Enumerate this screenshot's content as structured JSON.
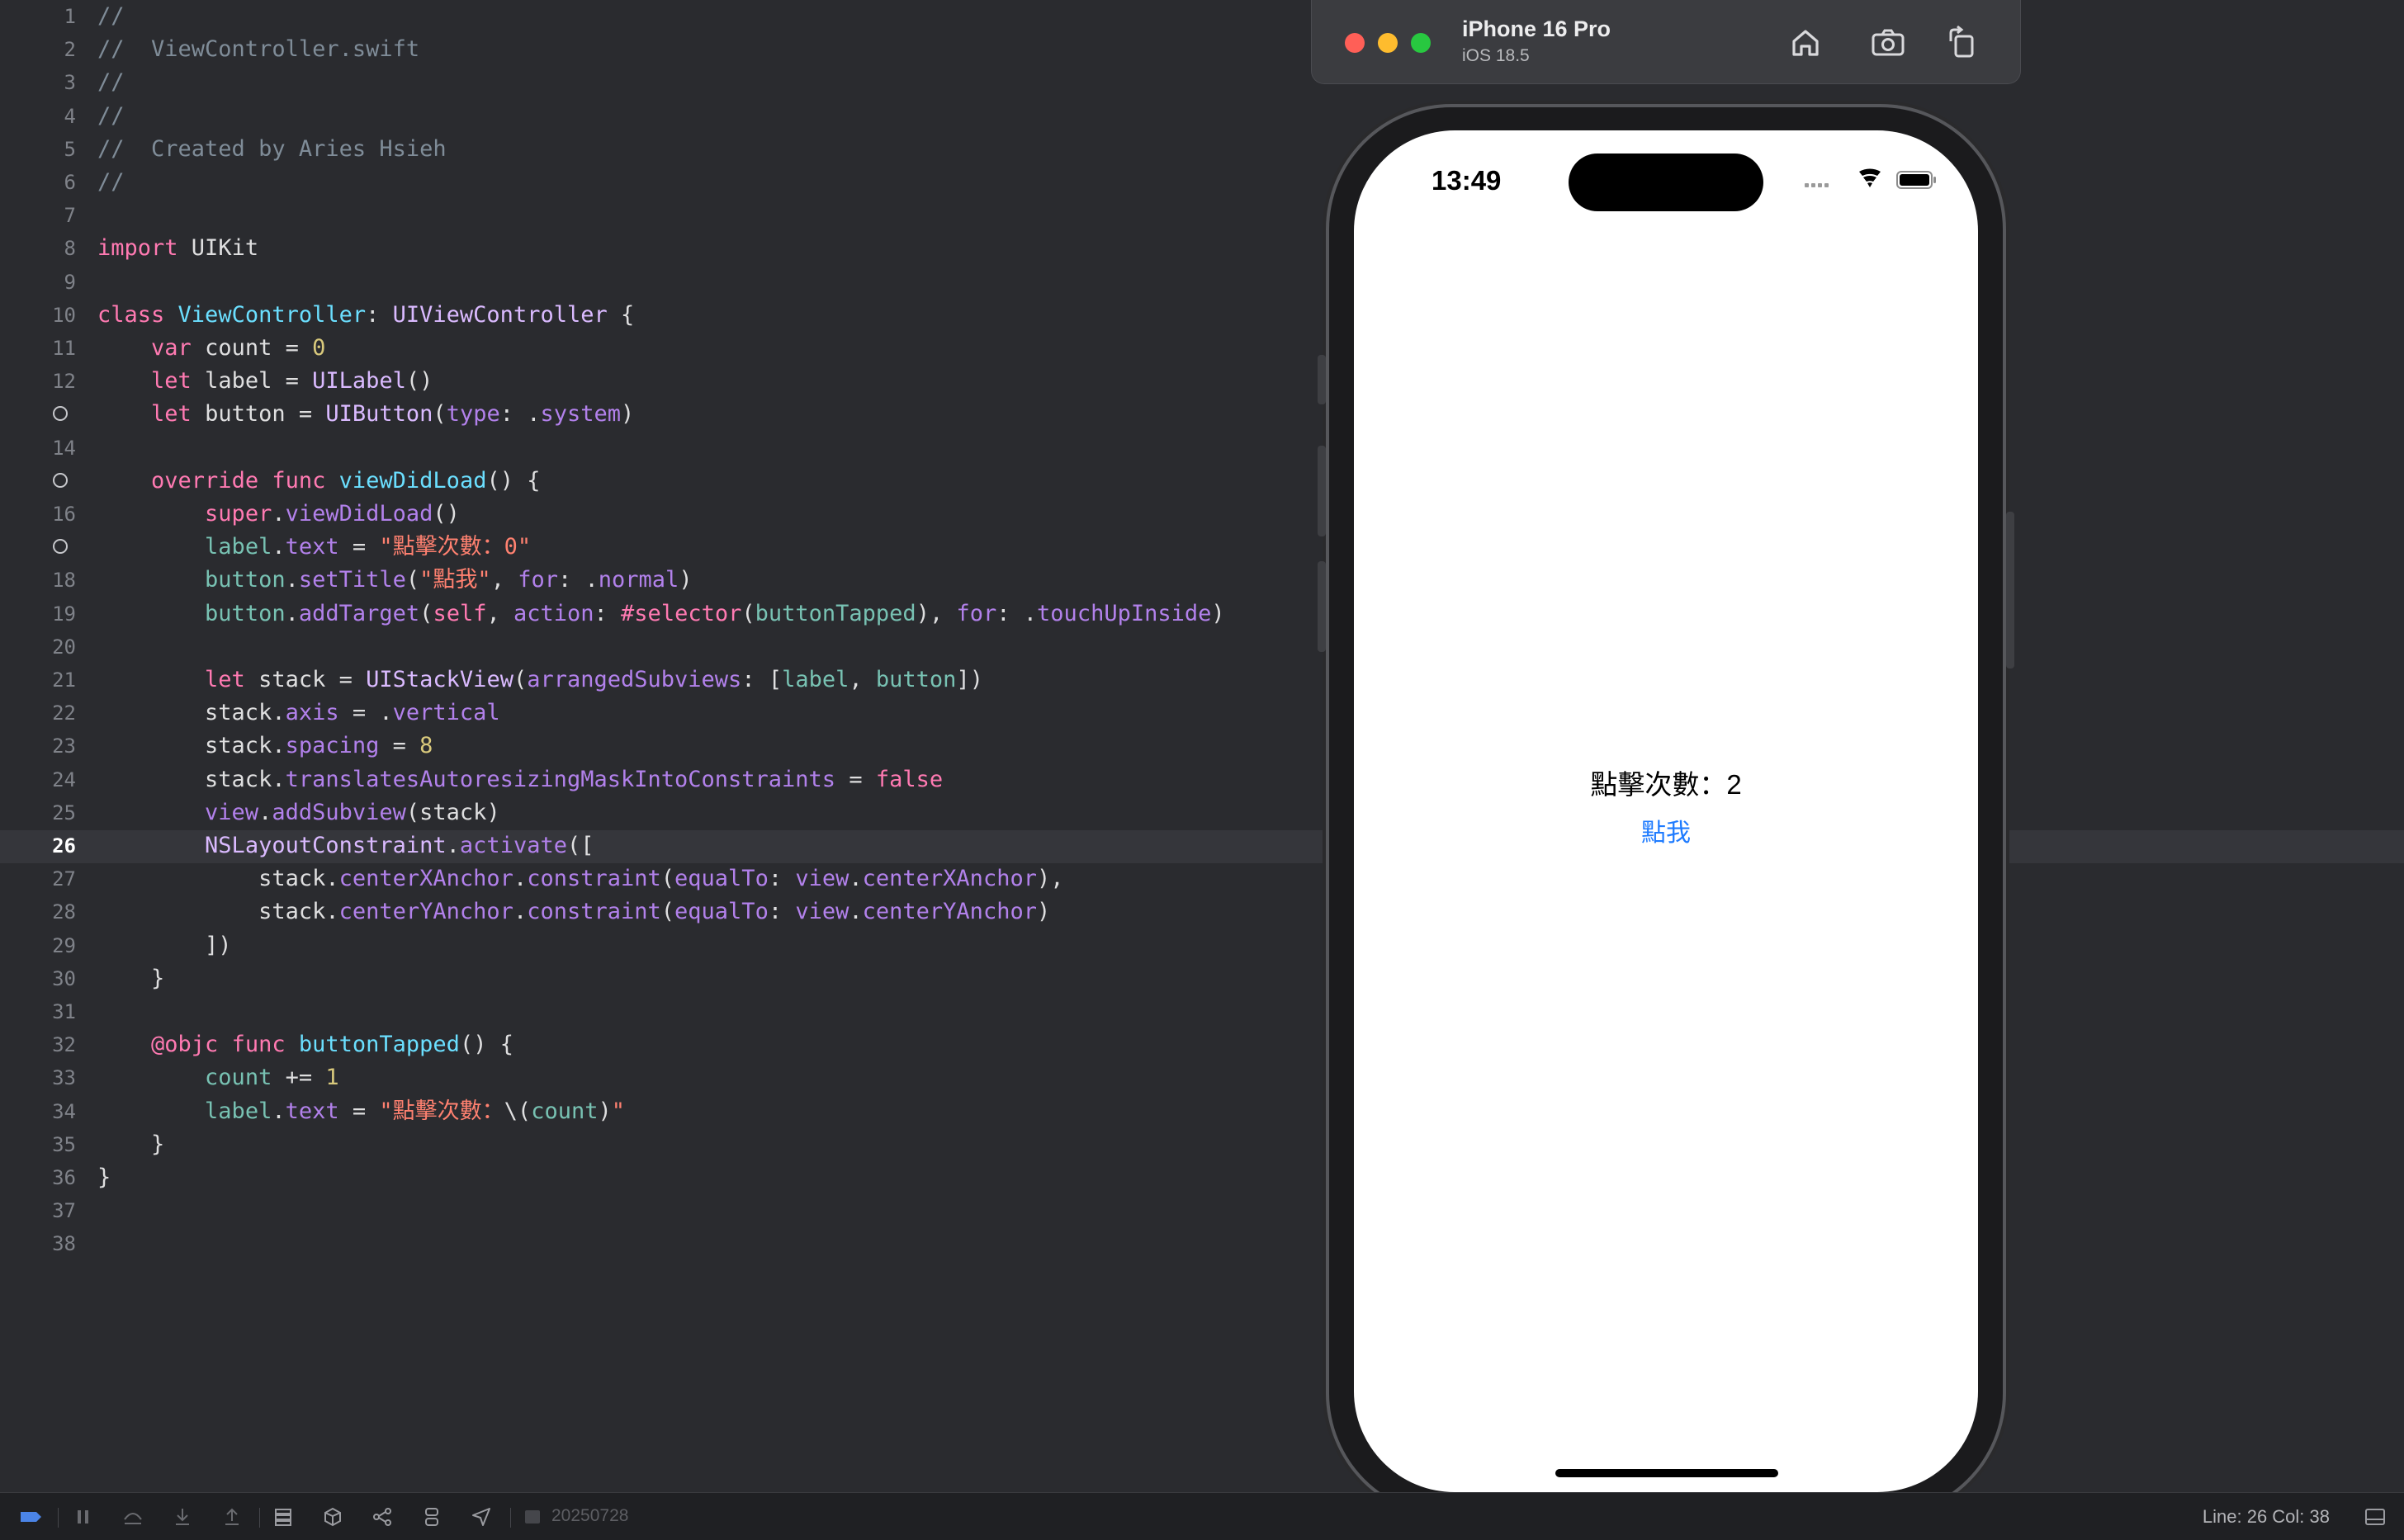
{
  "editor": {
    "current_line": 26,
    "lines": [
      {
        "n": "1",
        "tokens": [
          {
            "t": "//",
            "c": "comment"
          }
        ]
      },
      {
        "n": "2",
        "tokens": [
          {
            "t": "//  ViewController.swift",
            "c": "comment"
          }
        ]
      },
      {
        "n": "3",
        "tokens": [
          {
            "t": "//",
            "c": "comment"
          }
        ]
      },
      {
        "n": "4",
        "tokens": [
          {
            "t": "//",
            "c": "comment"
          }
        ]
      },
      {
        "n": "5",
        "tokens": [
          {
            "t": "//  Created by Aries Hsieh",
            "c": "comment"
          }
        ]
      },
      {
        "n": "6",
        "tokens": [
          {
            "t": "//",
            "c": "comment"
          }
        ]
      },
      {
        "n": "7",
        "tokens": []
      },
      {
        "n": "8",
        "tokens": [
          {
            "t": "import",
            "c": "keyword"
          },
          {
            "t": " UIKit",
            "c": "plain"
          }
        ]
      },
      {
        "n": "9",
        "tokens": []
      },
      {
        "n": "10",
        "tokens": [
          {
            "t": "class",
            "c": "keyword"
          },
          {
            "t": " ",
            "c": "plain"
          },
          {
            "t": "ViewController",
            "c": "project"
          },
          {
            "t": ": ",
            "c": "plain"
          },
          {
            "t": "UIViewController",
            "c": "type"
          },
          {
            "t": " {",
            "c": "plain"
          }
        ]
      },
      {
        "n": "11",
        "tokens": [
          {
            "t": "    ",
            "c": "plain"
          },
          {
            "t": "var",
            "c": "keyword"
          },
          {
            "t": " count = ",
            "c": "plain"
          },
          {
            "t": "0",
            "c": "number"
          }
        ]
      },
      {
        "n": "12",
        "tokens": [
          {
            "t": "    ",
            "c": "plain"
          },
          {
            "t": "let",
            "c": "keyword"
          },
          {
            "t": " label = ",
            "c": "plain"
          },
          {
            "t": "UILabel",
            "c": "type"
          },
          {
            "t": "()",
            "c": "plain"
          }
        ]
      },
      {
        "n": "13",
        "breakpoint": true,
        "tokens": [
          {
            "t": "    ",
            "c": "plain"
          },
          {
            "t": "let",
            "c": "keyword"
          },
          {
            "t": " button = ",
            "c": "plain"
          },
          {
            "t": "UIButton",
            "c": "type"
          },
          {
            "t": "(",
            "c": "plain"
          },
          {
            "t": "type",
            "c": "member"
          },
          {
            "t": ": .",
            "c": "plain"
          },
          {
            "t": "system",
            "c": "member"
          },
          {
            "t": ")",
            "c": "plain"
          }
        ]
      },
      {
        "n": "14",
        "tokens": []
      },
      {
        "n": "15",
        "breakpoint": true,
        "tokens": [
          {
            "t": "    ",
            "c": "plain"
          },
          {
            "t": "override",
            "c": "keyword"
          },
          {
            "t": " ",
            "c": "plain"
          },
          {
            "t": "func",
            "c": "keyword"
          },
          {
            "t": " ",
            "c": "plain"
          },
          {
            "t": "viewDidLoad",
            "c": "project"
          },
          {
            "t": "() {",
            "c": "plain"
          }
        ]
      },
      {
        "n": "16",
        "tokens": [
          {
            "t": "        ",
            "c": "plain"
          },
          {
            "t": "super",
            "c": "keyword"
          },
          {
            "t": ".",
            "c": "plain"
          },
          {
            "t": "viewDidLoad",
            "c": "member"
          },
          {
            "t": "()",
            "c": "plain"
          }
        ]
      },
      {
        "n": "17",
        "breakpoint": true,
        "tokens": [
          {
            "t": "        ",
            "c": "plain"
          },
          {
            "t": "label",
            "c": "projmember"
          },
          {
            "t": ".",
            "c": "plain"
          },
          {
            "t": "text",
            "c": "member"
          },
          {
            "t": " = ",
            "c": "plain"
          },
          {
            "t": "\"點擊次數：0\"",
            "c": "string"
          }
        ]
      },
      {
        "n": "18",
        "tokens": [
          {
            "t": "        ",
            "c": "plain"
          },
          {
            "t": "button",
            "c": "projmember"
          },
          {
            "t": ".",
            "c": "plain"
          },
          {
            "t": "setTitle",
            "c": "member"
          },
          {
            "t": "(",
            "c": "plain"
          },
          {
            "t": "\"點我\"",
            "c": "string"
          },
          {
            "t": ", ",
            "c": "plain"
          },
          {
            "t": "for",
            "c": "member"
          },
          {
            "t": ": .",
            "c": "plain"
          },
          {
            "t": "normal",
            "c": "member"
          },
          {
            "t": ")",
            "c": "plain"
          }
        ]
      },
      {
        "n": "19",
        "tokens": [
          {
            "t": "        ",
            "c": "plain"
          },
          {
            "t": "button",
            "c": "projmember"
          },
          {
            "t": ".",
            "c": "plain"
          },
          {
            "t": "addTarget",
            "c": "member"
          },
          {
            "t": "(",
            "c": "plain"
          },
          {
            "t": "self",
            "c": "keyword"
          },
          {
            "t": ", ",
            "c": "plain"
          },
          {
            "t": "action",
            "c": "member"
          },
          {
            "t": ": ",
            "c": "plain"
          },
          {
            "t": "#selector",
            "c": "keyword"
          },
          {
            "t": "(",
            "c": "plain"
          },
          {
            "t": "buttonTapped",
            "c": "projmember"
          },
          {
            "t": "), ",
            "c": "plain"
          },
          {
            "t": "for",
            "c": "member"
          },
          {
            "t": ": .",
            "c": "plain"
          },
          {
            "t": "touchUpInside",
            "c": "member"
          },
          {
            "t": ")",
            "c": "plain"
          }
        ]
      },
      {
        "n": "20",
        "tokens": []
      },
      {
        "n": "21",
        "tokens": [
          {
            "t": "        ",
            "c": "plain"
          },
          {
            "t": "let",
            "c": "keyword"
          },
          {
            "t": " stack = ",
            "c": "plain"
          },
          {
            "t": "UIStackView",
            "c": "type"
          },
          {
            "t": "(",
            "c": "plain"
          },
          {
            "t": "arrangedSubviews",
            "c": "member"
          },
          {
            "t": ": [",
            "c": "plain"
          },
          {
            "t": "label",
            "c": "projmember"
          },
          {
            "t": ", ",
            "c": "plain"
          },
          {
            "t": "button",
            "c": "projmember"
          },
          {
            "t": "])",
            "c": "plain"
          }
        ]
      },
      {
        "n": "22",
        "tokens": [
          {
            "t": "        stack.",
            "c": "plain"
          },
          {
            "t": "axis",
            "c": "member"
          },
          {
            "t": " = .",
            "c": "plain"
          },
          {
            "t": "vertical",
            "c": "member"
          }
        ]
      },
      {
        "n": "23",
        "tokens": [
          {
            "t": "        stack.",
            "c": "plain"
          },
          {
            "t": "spacing",
            "c": "member"
          },
          {
            "t": " = ",
            "c": "plain"
          },
          {
            "t": "8",
            "c": "number"
          }
        ]
      },
      {
        "n": "24",
        "tokens": [
          {
            "t": "        stack.",
            "c": "plain"
          },
          {
            "t": "translatesAutoresizingMaskIntoConstraints",
            "c": "member"
          },
          {
            "t": " = ",
            "c": "plain"
          },
          {
            "t": "false",
            "c": "keyword"
          }
        ]
      },
      {
        "n": "25",
        "tokens": [
          {
            "t": "        ",
            "c": "plain"
          },
          {
            "t": "view",
            "c": "member"
          },
          {
            "t": ".",
            "c": "plain"
          },
          {
            "t": "addSubview",
            "c": "member"
          },
          {
            "t": "(stack)",
            "c": "plain"
          }
        ]
      },
      {
        "n": "26",
        "tokens": [
          {
            "t": "        ",
            "c": "plain"
          },
          {
            "t": "NSLayoutConstraint",
            "c": "type"
          },
          {
            "t": ".",
            "c": "plain"
          },
          {
            "t": "activate",
            "c": "member"
          },
          {
            "t": "([",
            "c": "plain"
          }
        ]
      },
      {
        "n": "27",
        "tokens": [
          {
            "t": "            stack.",
            "c": "plain"
          },
          {
            "t": "centerXAnchor",
            "c": "member"
          },
          {
            "t": ".",
            "c": "plain"
          },
          {
            "t": "constraint",
            "c": "member"
          },
          {
            "t": "(",
            "c": "plain"
          },
          {
            "t": "equalTo",
            "c": "member"
          },
          {
            "t": ": ",
            "c": "plain"
          },
          {
            "t": "view",
            "c": "member"
          },
          {
            "t": ".",
            "c": "plain"
          },
          {
            "t": "centerXAnchor",
            "c": "member"
          },
          {
            "t": "),",
            "c": "plain"
          }
        ]
      },
      {
        "n": "28",
        "tokens": [
          {
            "t": "            stack.",
            "c": "plain"
          },
          {
            "t": "centerYAnchor",
            "c": "member"
          },
          {
            "t": ".",
            "c": "plain"
          },
          {
            "t": "constraint",
            "c": "member"
          },
          {
            "t": "(",
            "c": "plain"
          },
          {
            "t": "equalTo",
            "c": "member"
          },
          {
            "t": ": ",
            "c": "plain"
          },
          {
            "t": "view",
            "c": "member"
          },
          {
            "t": ".",
            "c": "plain"
          },
          {
            "t": "centerYAnchor",
            "c": "member"
          },
          {
            "t": ")",
            "c": "plain"
          }
        ]
      },
      {
        "n": "29",
        "tokens": [
          {
            "t": "        ])",
            "c": "plain"
          }
        ]
      },
      {
        "n": "30",
        "tokens": [
          {
            "t": "    }",
            "c": "plain"
          }
        ]
      },
      {
        "n": "31",
        "tokens": []
      },
      {
        "n": "32",
        "tokens": [
          {
            "t": "    ",
            "c": "plain"
          },
          {
            "t": "@objc",
            "c": "keyword"
          },
          {
            "t": " ",
            "c": "plain"
          },
          {
            "t": "func",
            "c": "keyword"
          },
          {
            "t": " ",
            "c": "plain"
          },
          {
            "t": "buttonTapped",
            "c": "project"
          },
          {
            "t": "() {",
            "c": "plain"
          }
        ]
      },
      {
        "n": "33",
        "tokens": [
          {
            "t": "        ",
            "c": "plain"
          },
          {
            "t": "count",
            "c": "projmember"
          },
          {
            "t": " += ",
            "c": "plain"
          },
          {
            "t": "1",
            "c": "number"
          }
        ]
      },
      {
        "n": "34",
        "tokens": [
          {
            "t": "        ",
            "c": "plain"
          },
          {
            "t": "label",
            "c": "projmember"
          },
          {
            "t": ".",
            "c": "plain"
          },
          {
            "t": "text",
            "c": "member"
          },
          {
            "t": " = ",
            "c": "plain"
          },
          {
            "t": "\"點擊次數：",
            "c": "string"
          },
          {
            "t": "\\(",
            "c": "plain"
          },
          {
            "t": "count",
            "c": "projmember"
          },
          {
            "t": ")",
            "c": "plain"
          },
          {
            "t": "\"",
            "c": "string"
          }
        ]
      },
      {
        "n": "35",
        "tokens": [
          {
            "t": "    }",
            "c": "plain"
          }
        ]
      },
      {
        "n": "36",
        "tokens": [
          {
            "t": "}",
            "c": "plain"
          }
        ]
      },
      {
        "n": "37",
        "tokens": []
      },
      {
        "n": "38",
        "tokens": []
      }
    ]
  },
  "simulator": {
    "device_name": "iPhone 16 Pro",
    "os_version": "iOS 18.5",
    "toolbar_icons": [
      "home-icon",
      "screenshot-icon",
      "rotate-icon"
    ],
    "status_bar": {
      "time": "13:49",
      "icons": [
        "cellular-icon",
        "wifi-icon",
        "battery-icon"
      ]
    },
    "app": {
      "count_label": "點擊次數：2",
      "button_title": "點我"
    }
  },
  "bottom_bar": {
    "build_label": "20250728",
    "cursor_position": "Line: 26  Col: 38",
    "icons": [
      "breakpoint-toggle-icon",
      "pause-icon",
      "step-over-icon",
      "step-in-icon",
      "step-out-icon",
      "debug-view-hierarchy-icon",
      "memory-graph-icon",
      "environment-icon",
      "simulate-location-icon",
      "location-arrow-icon",
      "thread-icon",
      "console-toggle-icon"
    ]
  },
  "colors": {
    "editor_background": "#2a2b2f",
    "comment": "#7f8c98",
    "keyword": "#ff7ab2",
    "type": "#dabaff",
    "project": "#6bdfff",
    "string": "#ff8170",
    "number": "#d9c97c",
    "member": "#b281eb",
    "project_member": "#78c2b3",
    "ios_tint": "#1e7bff"
  }
}
